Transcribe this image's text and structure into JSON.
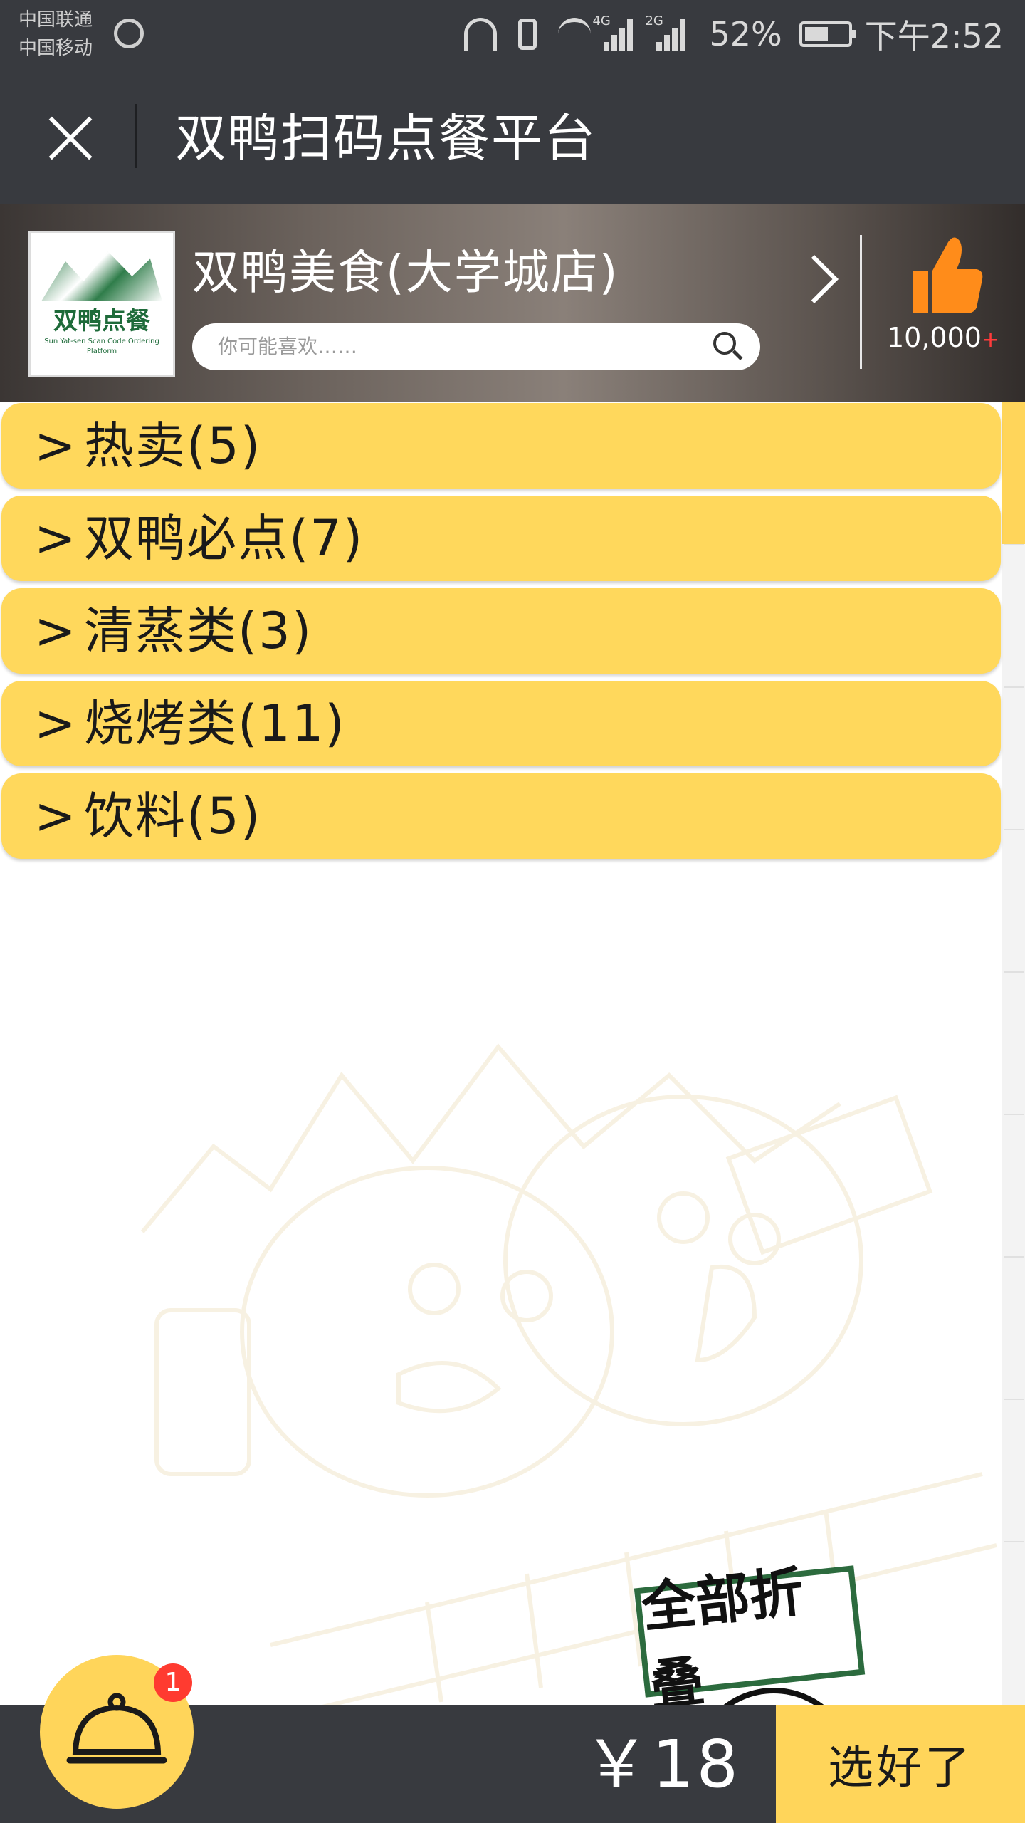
{
  "status_bar": {
    "carrier_1": "中国联通",
    "carrier_2": "中国移动",
    "signal_1_label": "4G",
    "signal_2_label": "2G",
    "battery": "52%",
    "time": "下午2:52",
    "icons": [
      "headphones-icon",
      "vibrate-icon",
      "wifi-icon",
      "signal-4g-icon",
      "signal-2g-icon",
      "battery-icon"
    ]
  },
  "title_bar": {
    "title": "双鸭扫码点餐平台",
    "close_icon": "close-icon"
  },
  "shop": {
    "name": "双鸭美食(大学城店)",
    "logo_text": "双鸭点餐",
    "logo_subtext": "Sun Yat-sen Scan Code Ordering Platform",
    "search_placeholder": "你可能喜欢……",
    "likes": "10,000",
    "likes_suffix": "+"
  },
  "categories": [
    {
      "chevron": ">",
      "label": "热卖(5)"
    },
    {
      "chevron": ">",
      "label": "双鸭必点(7)"
    },
    {
      "chevron": ">",
      "label": "清蒸类(3)"
    },
    {
      "chevron": ">",
      "label": "烧烤类(11)"
    },
    {
      "chevron": ">",
      "label": "饮料(5)"
    }
  ],
  "collapse_all": "全部折叠",
  "cart": {
    "badge": "1",
    "total": "￥18",
    "confirm": "选好了"
  },
  "colors": {
    "dark_bar": "#383a3f",
    "accent_yellow": "#ffd55a",
    "badge_red": "#ff3b30",
    "like_orange": "#ff8c1a"
  }
}
